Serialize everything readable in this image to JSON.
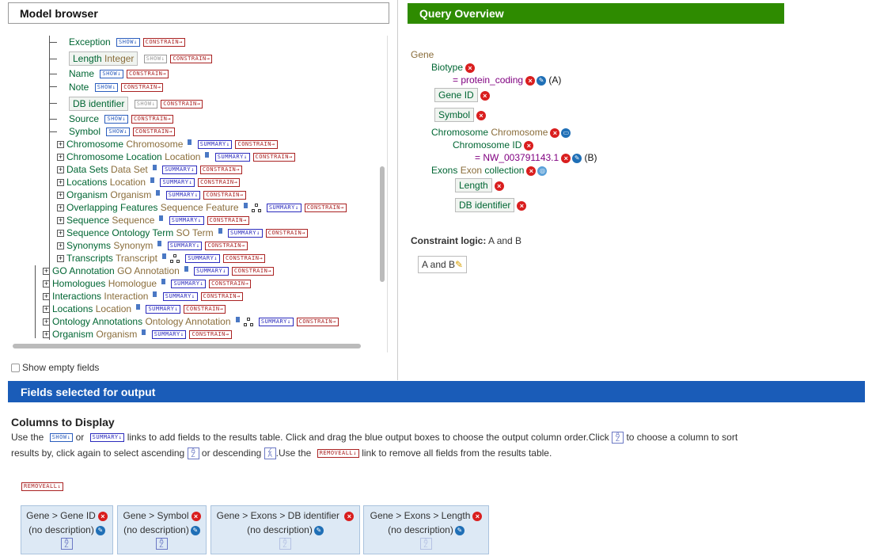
{
  "model_browser": {
    "title": "Model browser",
    "show_label": "SHOW",
    "constrain_label": "CONSTRAIN",
    "summary_label": "SUMMARY",
    "show_empty_label": "Show empty fields",
    "attributes": [
      {
        "name": "Exception",
        "type": "",
        "boxed": false
      },
      {
        "name": "Length",
        "type": "Integer",
        "boxed": true
      },
      {
        "name": "Name",
        "type": "",
        "boxed": false
      },
      {
        "name": "Note",
        "type": "",
        "boxed": false
      },
      {
        "name": "DB identifier",
        "type": "",
        "boxed": true
      },
      {
        "name": "Source",
        "type": "",
        "boxed": false
      },
      {
        "name": "Symbol",
        "type": "",
        "boxed": false
      }
    ],
    "exon_refs": [
      {
        "name": "Chromosome",
        "type": "Chromosome"
      },
      {
        "name": "Chromosome Location",
        "type": "Location"
      },
      {
        "name": "Data Sets",
        "type": "Data Set"
      },
      {
        "name": "Locations",
        "type": "Location"
      },
      {
        "name": "Organism",
        "type": "Organism"
      },
      {
        "name": "Overlapping Features",
        "type": "Sequence Feature"
      },
      {
        "name": "Sequence",
        "type": "Sequence"
      },
      {
        "name": "Sequence Ontology Term",
        "type": "SO Term"
      },
      {
        "name": "Synonyms",
        "type": "Synonym"
      },
      {
        "name": "Transcripts",
        "type": "Transcript"
      }
    ],
    "gene_refs": [
      {
        "name": "GO Annotation",
        "type": "GO Annotation"
      },
      {
        "name": "Homologues",
        "type": "Homologue"
      },
      {
        "name": "Interactions",
        "type": "Interaction"
      },
      {
        "name": "Locations",
        "type": "Location"
      },
      {
        "name": "Ontology Annotations",
        "type": "Ontology Annotation"
      },
      {
        "name": "Organism",
        "type": "Organism"
      }
    ]
  },
  "query_overview": {
    "title": "Query Overview",
    "root": "Gene",
    "biotype": "Biotype",
    "biotype_constraint": "= protein_coding",
    "biotype_code": "(A)",
    "gene_id": "Gene ID",
    "symbol": "Symbol",
    "chromosome": "Chromosome",
    "chromosome_type": "Chromosome",
    "chromosome_id": "Chromosome ID",
    "chromosome_constraint": "= NW_003791143.1",
    "chromosome_code": "(B)",
    "exons": "Exons",
    "exons_type": "Exon",
    "exons_collection": "collection",
    "length": "Length",
    "db_identifier": "DB identifier",
    "logic_label": "Constraint logic:",
    "logic_value": "A and B",
    "logic_box": "A and B"
  },
  "fields_selected": {
    "title": "Fields selected for output",
    "columns_title": "Columns to Display",
    "line1_a": "Use the",
    "line1_b": "or",
    "line1_c": "links to add fields to the results table. Click and drag the blue output boxes to choose the output column order.Click",
    "line1_d": "to choose a column to sort",
    "line2_a": "results by, click again to select ascending",
    "line2_b": "or descending",
    "line2_c": ".Use the",
    "line2_d": "link to remove all fields from the results table.",
    "remove_all_label": "REMOVEALL",
    "columns": [
      {
        "path": "Gene > Gene ID",
        "desc": "(no description)"
      },
      {
        "path": "Gene > Symbol",
        "desc": "(no description)"
      },
      {
        "path": "Gene > Exons > DB identifier",
        "desc": "(no description)"
      },
      {
        "path": "Gene > Exons > Length",
        "desc": "(no description)"
      }
    ]
  },
  "colors": {
    "query_header": "#2e8b00",
    "fields_header": "#1a5cb8",
    "attr_green": "#006633",
    "type_brown": "#8a6d3b"
  }
}
